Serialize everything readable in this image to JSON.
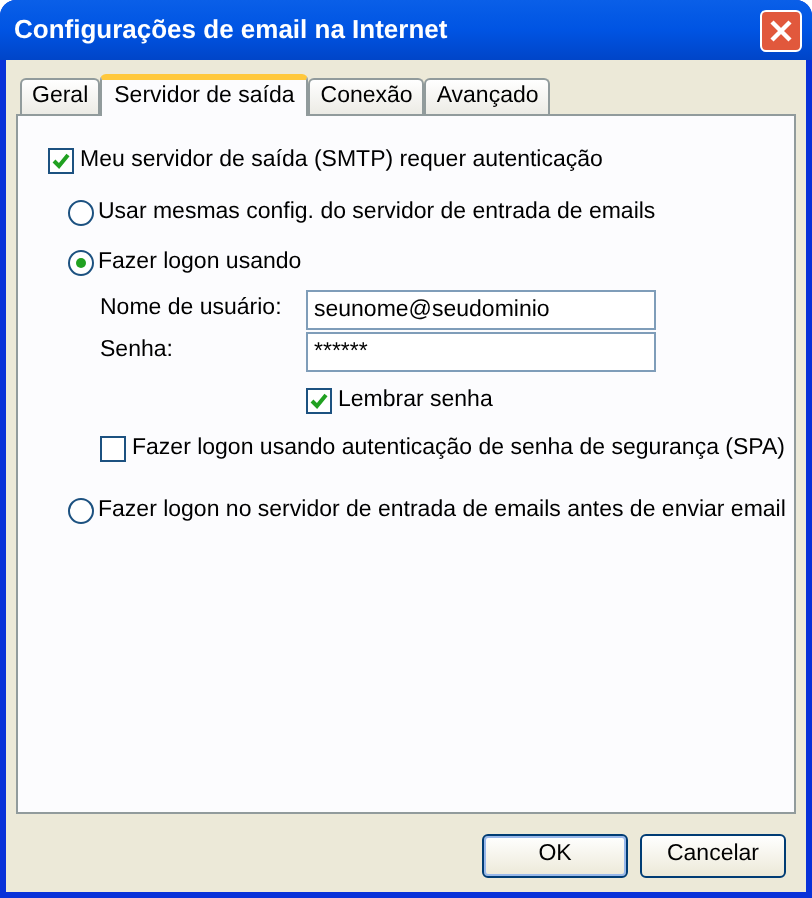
{
  "window": {
    "title": "Configurações de email na Internet"
  },
  "tabs": [
    {
      "label": "Geral",
      "selected": false
    },
    {
      "label": "Servidor de saída",
      "selected": true
    },
    {
      "label": "Conexão",
      "selected": false
    },
    {
      "label": "Avançado",
      "selected": false
    }
  ],
  "require_auth": {
    "label": "Meu servidor de saída (SMTP) requer autenticação",
    "checked": true
  },
  "logon_options": [
    {
      "label": "Usar mesmas config. do servidor de entrada de emails",
      "selected": false
    },
    {
      "label": "Fazer logon usando",
      "selected": true,
      "credentials": {
        "username": {
          "label": "Nome de usuário:",
          "value": "seunome@seudominio"
        },
        "password": {
          "label": "Senha:",
          "value": "******"
        },
        "remember": {
          "label": "Lembrar senha",
          "checked": true
        },
        "spa": {
          "label": "Fazer logon usando autenticação de senha de segurança (SPA)",
          "checked": false
        }
      }
    },
    {
      "label": "Fazer logon no servidor de entrada de emails antes de enviar email",
      "selected": false
    }
  ],
  "buttons": [
    "OK",
    "Cancelar"
  ]
}
